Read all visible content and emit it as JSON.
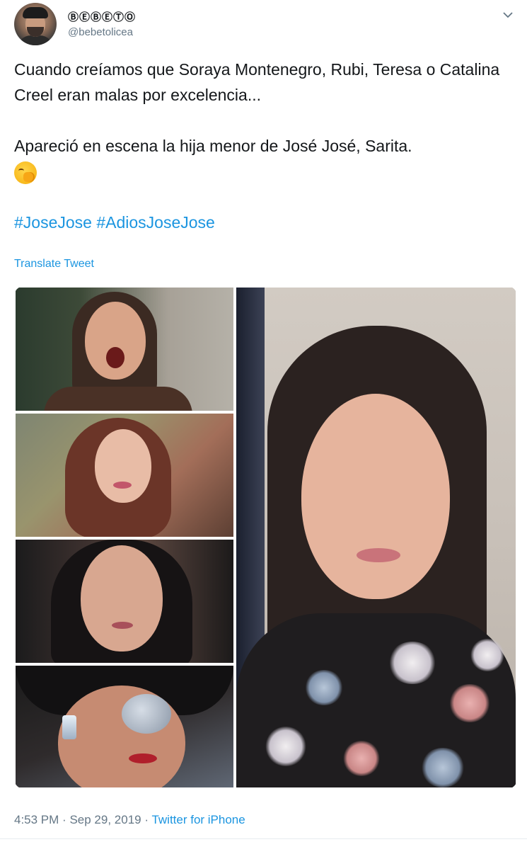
{
  "user": {
    "display_name": "ⒷⒺⒷⒺⓉⓄ",
    "handle": "@bebetolicea"
  },
  "tweet": {
    "line1": "Cuando creíamos que Soraya Montenegro, Rubi, Teresa o Catalina Creel eran  malas por excelencia...",
    "line2": "Apareció en escena la hija menor de José José, Sarita.",
    "emoji": "face-with-hand-over-mouth",
    "hashtags": [
      "#JoseJose",
      "#AdiosJoseJose"
    ]
  },
  "actions": {
    "translate_label": "Translate Tweet"
  },
  "meta": {
    "time": "4:53 PM",
    "separator": "·",
    "date": "Sep 29, 2019",
    "source": "Twitter for iPhone"
  },
  "colors": {
    "link": "#1b95e0",
    "secondary_text": "#657786",
    "primary_text": "#14171a"
  }
}
